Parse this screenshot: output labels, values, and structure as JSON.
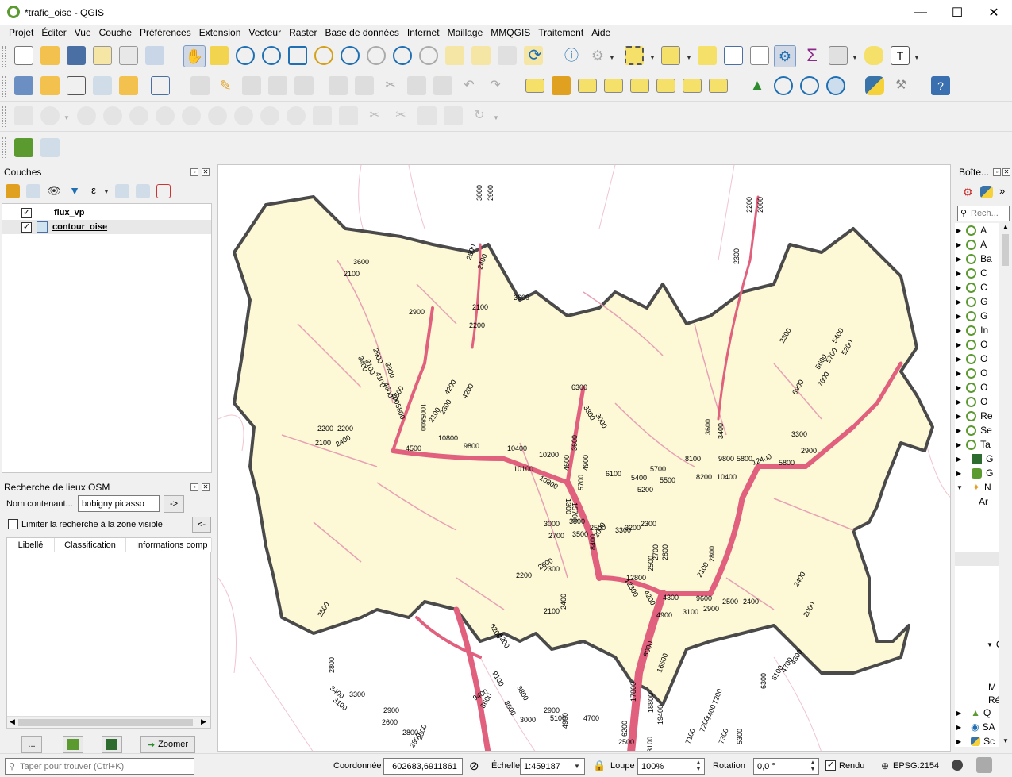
{
  "window": {
    "title": "*trafic_oise - QGIS"
  },
  "menu": [
    "Projet",
    "Éditer",
    "Vue",
    "Couche",
    "Préférences",
    "Extension",
    "Vecteur",
    "Raster",
    "Base de données",
    "Internet",
    "Maillage",
    "MMQGIS",
    "Traitement",
    "Aide"
  ],
  "layers_panel": {
    "title": "Couches",
    "layers": [
      {
        "name": "flux_vp",
        "checked": true,
        "style": "line"
      },
      {
        "name": "contour_oise",
        "checked": true,
        "style": "polygon"
      }
    ]
  },
  "osm_panel": {
    "title": "Recherche de lieux OSM",
    "name_label": "Nom contenant...",
    "name_value": "bobigny picasso",
    "go_button": "->",
    "limit_checkbox": "Limiter la recherche à la zone visible",
    "back_button": "<-",
    "columns": [
      "Libellé",
      "Classification",
      "Informations comp"
    ],
    "more_button": "...",
    "zoom_button": "Zoomer"
  },
  "toolbox": {
    "title": "Boîte...",
    "search_placeholder": "Rech...",
    "items": [
      "A",
      "A",
      "Ba",
      "C",
      "C",
      "G",
      "G",
      "In",
      "O",
      "O",
      "O",
      "O",
      "O",
      "Re",
      "Se",
      "Ta",
      "G",
      "G",
      "N",
      "Ar"
    ],
    "bottom_items": [
      "Ca",
      "M",
      "Ré",
      "Q",
      "SA",
      "Sc"
    ]
  },
  "map": {
    "labels": [
      "3000",
      "2900",
      "2200",
      "2000",
      "2300",
      "3600",
      "2100",
      "2500",
      "2400",
      "2900",
      "2100",
      "2200",
      "3600",
      "3400",
      "2900",
      "3100",
      "3900",
      "4100",
      "4600",
      "1005800",
      "4500",
      "5500",
      "2100",
      "2300",
      "4200",
      "4200",
      "6300",
      "3300",
      "3000",
      "10800",
      "9800",
      "10400",
      "10200",
      "10100",
      "10800",
      "3600",
      "4600",
      "4900",
      "5700",
      "6100",
      "5400",
      "5700",
      "5200",
      "5500",
      "3600",
      "3400",
      "8100",
      "9800",
      "5800",
      "12400",
      "5800",
      "8200",
      "10400",
      "2900",
      "6900",
      "5400",
      "7600",
      "5600",
      "5700",
      "5200",
      "2300",
      "3300",
      "1300",
      "15700",
      "3800",
      "3500",
      "2700",
      "2500",
      "3000",
      "2600",
      "2100",
      "2200",
      "2300",
      "2400",
      "2000",
      "3300",
      "8400",
      "3200",
      "2300",
      "2800",
      "2700",
      "2500",
      "4200",
      "12300",
      "12800",
      "4300",
      "4900",
      "3100",
      "2900",
      "2500",
      "2400",
      "2100",
      "9600",
      "2800",
      "8000",
      "16600",
      "17800",
      "6200",
      "18800",
      "19400",
      "6300",
      "5300",
      "6100",
      "4700",
      "4300",
      "2000",
      "2400",
      "1005800",
      "2200",
      "2100",
      "2200",
      "2400",
      "2500",
      "2800",
      "3400",
      "3100",
      "3300",
      "2900",
      "2600",
      "2300",
      "2800",
      "6200",
      "5200",
      "9100",
      "9400",
      "8600",
      "3800",
      "3600",
      "2900",
      "3000",
      "5100",
      "4900",
      "4700",
      "2500",
      "7100",
      "7200",
      "7400",
      "7200",
      "7300",
      "3100",
      "2800"
    ],
    "lines_color": "#e0607e",
    "region_fill": "#fdf9d6",
    "outline_color": "#4a4a4a"
  },
  "status": {
    "search_placeholder": "Taper pour trouver (Ctrl+K)",
    "coord_label": "Coordonnée",
    "coord_value": "602683,6911861",
    "scale_label": "Échelle",
    "scale_value": "1:459187",
    "magnifier_label": "Loupe",
    "magnifier_value": "100%",
    "rotation_label": "Rotation",
    "rotation_value": "0,0 °",
    "render_label": "Rendu",
    "crs": "EPSG:2154"
  }
}
